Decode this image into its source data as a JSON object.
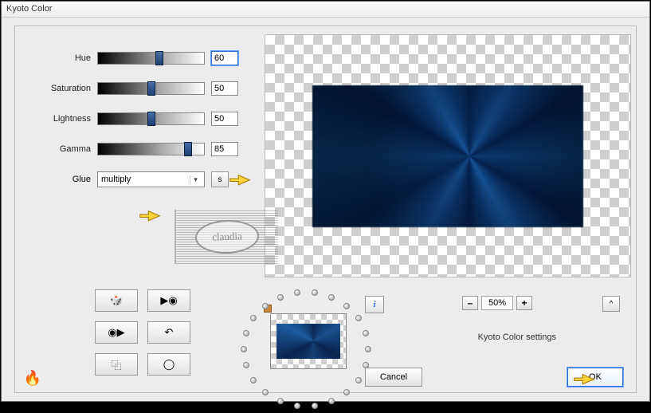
{
  "window": {
    "title": "Kyoto Color"
  },
  "sliders": {
    "hue": {
      "label": "Hue",
      "value": "60",
      "pos": 72
    },
    "saturation": {
      "label": "Saturation",
      "value": "50",
      "pos": 62
    },
    "lightness": {
      "label": "Lightness",
      "value": "50",
      "pos": 62
    },
    "gamma": {
      "label": "Gamma",
      "value": "85",
      "pos": 108
    }
  },
  "glue": {
    "label": "Glue",
    "selected": "multiply",
    "s_btn": "s"
  },
  "util_icons": {
    "dice": "🎲",
    "play": "▶◉",
    "disc": "◉▶",
    "undo": "↶",
    "copy": "⿻",
    "ring": "◯"
  },
  "flame_icon": "🔥",
  "info_btn": "i",
  "zoom": {
    "minus": "–",
    "value": "50%",
    "plus": "+"
  },
  "caret": "^",
  "settings_label": "Kyoto Color settings",
  "cancel": "Cancel",
  "ok": "OK",
  "watermark": "claudia"
}
